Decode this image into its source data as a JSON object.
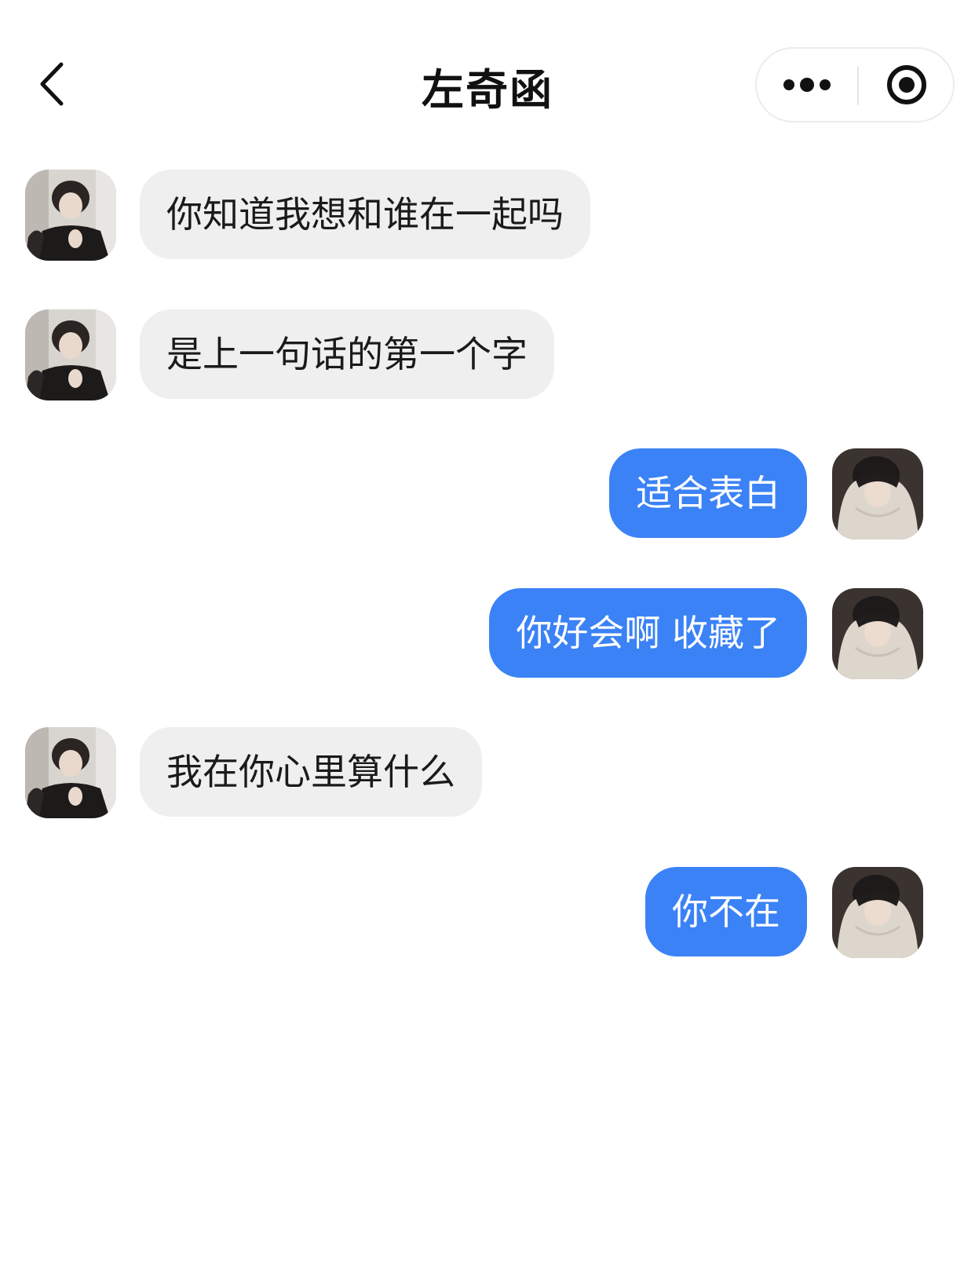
{
  "header": {
    "title": "左奇函",
    "back_icon": "chevron-left-icon",
    "more_icon": "more-dots-icon",
    "close_icon": "target-circle-icon"
  },
  "messages": [
    {
      "side": "in",
      "text": "你知道我想和谁在一起吗"
    },
    {
      "side": "in",
      "text": "是上一句话的第一个字"
    },
    {
      "side": "out",
      "text": "适合表白"
    },
    {
      "side": "out",
      "text": "你好会啊 收藏了"
    },
    {
      "side": "in",
      "text": "我在你心里算什么"
    },
    {
      "side": "out",
      "text": "你不在"
    }
  ],
  "colors": {
    "incoming_bubble": "#efefef",
    "outgoing_bubble": "#3b82f6",
    "text_dark": "#1a1a1a",
    "text_light": "#ffffff"
  }
}
